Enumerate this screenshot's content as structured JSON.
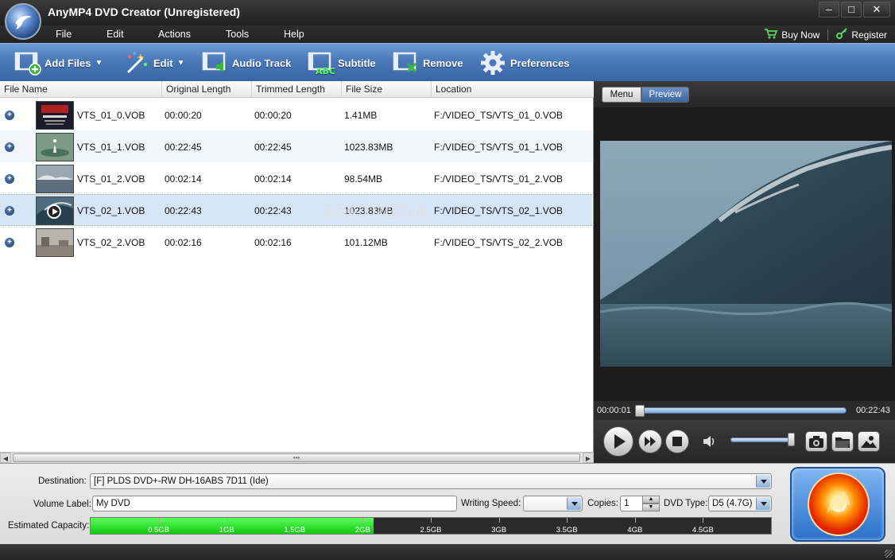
{
  "window": {
    "title": "AnyMP4 DVD Creator (Unregistered)"
  },
  "menu": {
    "items": [
      "File",
      "Edit",
      "Actions",
      "Tools",
      "Help"
    ],
    "buy_now": "Buy Now",
    "register": "Register"
  },
  "toolbar": {
    "add_files": "Add Files",
    "edit": "Edit",
    "audio_track": "Audio Track",
    "subtitle": "Subtitle",
    "remove": "Remove",
    "preferences": "Preferences"
  },
  "file_list": {
    "columns": [
      "File Name",
      "Original Length",
      "Trimmed Length",
      "File Size",
      "Location"
    ],
    "rows": [
      {
        "name": "VTS_01_0.VOB",
        "original": "00:00:20",
        "trimmed": "00:00:20",
        "size": "1.41MB",
        "location": "F:/VIDEO_TS/VTS_01_0.VOB"
      },
      {
        "name": "VTS_01_1.VOB",
        "original": "00:22:45",
        "trimmed": "00:22:45",
        "size": "1023.83MB",
        "location": "F:/VIDEO_TS/VTS_01_1.VOB"
      },
      {
        "name": "VTS_01_2.VOB",
        "original": "00:02:14",
        "trimmed": "00:02:14",
        "size": "98.54MB",
        "location": "F:/VIDEO_TS/VTS_01_2.VOB"
      },
      {
        "name": "VTS_02_1.VOB",
        "original": "00:22:43",
        "trimmed": "00:22:43",
        "size": "1023.83MB",
        "location": "F:/VIDEO_TS/VTS_02_1.VOB"
      },
      {
        "name": "VTS_02_2.VOB",
        "original": "00:02:16",
        "trimmed": "00:02:16",
        "size": "101.12MB",
        "location": "F:/VIDEO_TS/VTS_02_2.VOB"
      }
    ],
    "selected_index": 3,
    "watermark": "SOFTPEDIA"
  },
  "preview": {
    "tab_menu": "Menu",
    "tab_preview": "Preview",
    "active_tab": "Preview",
    "time_current": "00:00:01",
    "time_total": "00:22:43",
    "position_fraction": 0.0007,
    "volume_fraction": 1.0
  },
  "bottom": {
    "destination_label": "Destination:",
    "destination_value": "[F] PLDS DVD+-RW DH-16ABS 7D11 (Ide)",
    "volume_label": "Volume Label:",
    "volume_value": "My DVD",
    "writing_speed_label": "Writing Speed:",
    "writing_speed_value": "",
    "copies_label": "Copies:",
    "copies_value": "1",
    "dvd_type_label": "DVD Type:",
    "dvd_type_value": "D5 (4.7G)",
    "capacity_label": "Estimated Capacity:",
    "capacity_ticks": [
      "0.5GB",
      "1GB",
      "1.5GB",
      "2GB",
      "2.5GB",
      "3GB",
      "3.5GB",
      "4GB",
      "4.5GB"
    ],
    "capacity_used_gb": 2.08,
    "capacity_max_gb": 5.0
  },
  "colors": {
    "toolbar_blue": "#4a78b8",
    "capacity_green": "#10c810",
    "selected_row": "#d7e6f7"
  }
}
